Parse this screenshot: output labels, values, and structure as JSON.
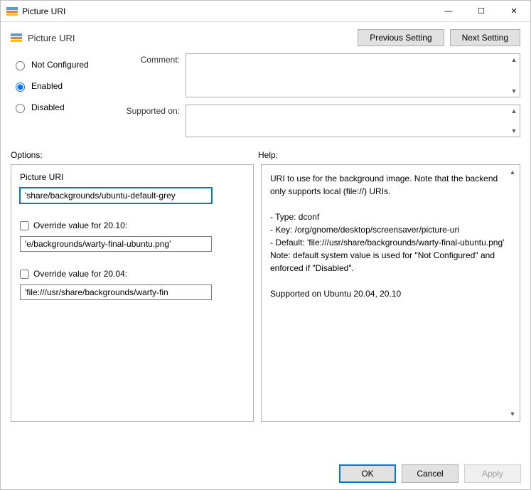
{
  "window": {
    "title": "Picture URI",
    "minimize": "—",
    "maximize": "☐",
    "close": "✕"
  },
  "header": {
    "title": "Picture URI",
    "prev": "Previous Setting",
    "next": "Next Setting"
  },
  "radios": {
    "not_configured": "Not Configured",
    "enabled": "Enabled",
    "disabled": "Disabled",
    "selected": "enabled"
  },
  "fields": {
    "comment_label": "Comment:",
    "supported_label": "Supported on:"
  },
  "labels": {
    "options": "Options:",
    "help": "Help:"
  },
  "options": {
    "picture_uri_label": "Picture URI",
    "picture_uri_value": "'share/backgrounds/ubuntu-default-grey",
    "override_2010_label": "Override value for 20.10:",
    "override_2010_value": "'e/backgrounds/warty-final-ubuntu.png'",
    "override_2004_label": "Override value for 20.04:",
    "override_2004_value": "'file:///usr/share/backgrounds/warty-fin"
  },
  "help_text": "URI to use for the background image. Note that the backend only supports local (file://) URIs.\n\n- Type: dconf\n- Key: /org/gnome/desktop/screensaver/picture-uri\n- Default: 'file:///usr/share/backgrounds/warty-final-ubuntu.png'\nNote: default system value is used for \"Not Configured\" and enforced if \"Disabled\".\n\nSupported on Ubuntu 20.04, 20.10",
  "footer": {
    "ok": "OK",
    "cancel": "Cancel",
    "apply": "Apply"
  }
}
